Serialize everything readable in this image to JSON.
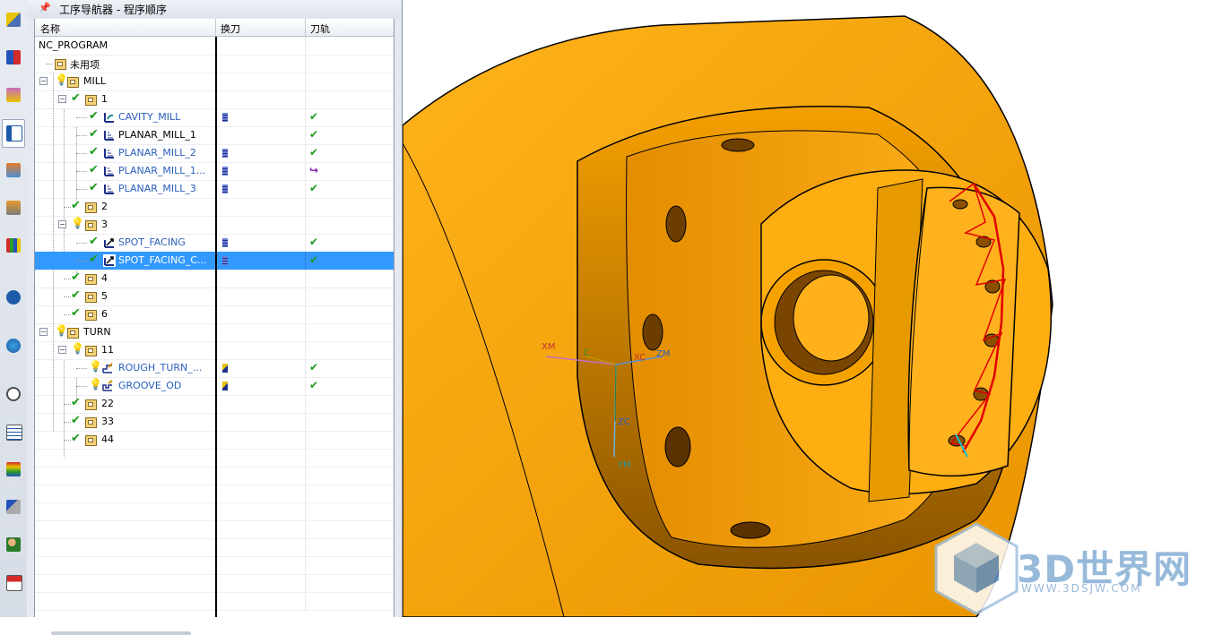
{
  "navigator": {
    "title": "工序导航器 - 程序顺序",
    "columns": {
      "name": "名称",
      "tool_change": "换刀",
      "toolpath": "刀轨"
    },
    "rows": [
      {
        "label": "NC_PROGRAM"
      },
      {
        "label": "未用项"
      },
      {
        "label": "MILL"
      },
      {
        "label": "1"
      },
      {
        "label": "CAVITY_MILL"
      },
      {
        "label": "PLANAR_MILL_1"
      },
      {
        "label": "PLANAR_MILL_2"
      },
      {
        "label": "PLANAR_MILL_1..."
      },
      {
        "label": "PLANAR_MILL_3"
      },
      {
        "label": "2"
      },
      {
        "label": "3"
      },
      {
        "label": "SPOT_FACING"
      },
      {
        "label": "SPOT_FACING_C..."
      },
      {
        "label": "4"
      },
      {
        "label": "5"
      },
      {
        "label": "6"
      },
      {
        "label": "TURN"
      },
      {
        "label": "11"
      },
      {
        "label": "ROUGH_TURN_..."
      },
      {
        "label": "GROOVE_OD"
      },
      {
        "label": "22"
      },
      {
        "label": "33"
      },
      {
        "label": "44"
      }
    ]
  },
  "viewport": {
    "axis_labels": {
      "xm": "XM",
      "zm": "ZM",
      "ym": "YM",
      "xc": "XC",
      "zc": "ZC",
      "c": "C"
    },
    "part_color": "#ffaa00"
  },
  "watermark": {
    "brand": "3D世界网",
    "url": "WWW.3DSJW.COM"
  }
}
